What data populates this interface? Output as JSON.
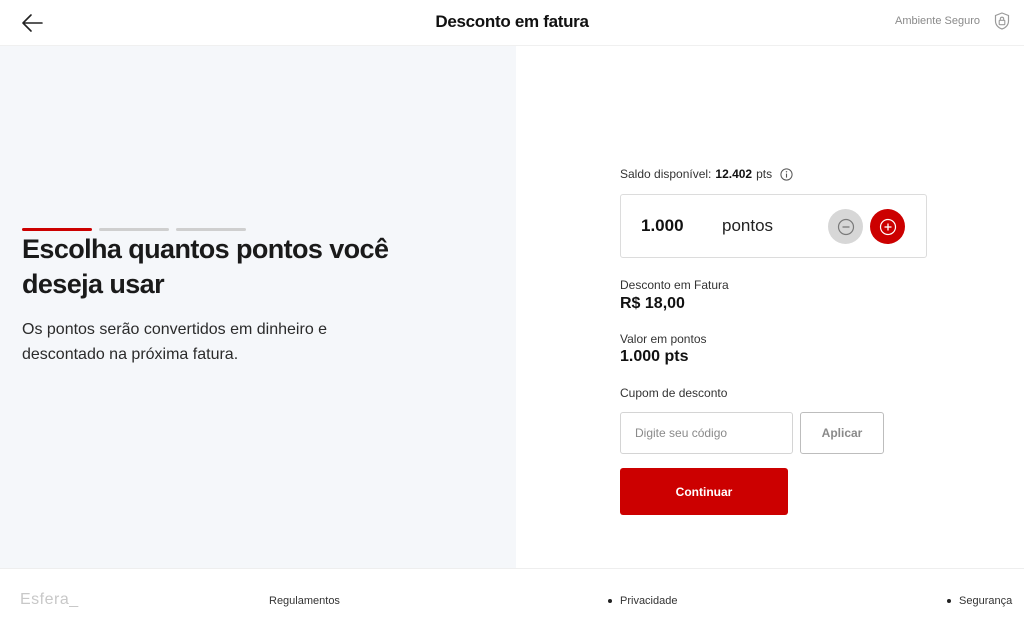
{
  "header": {
    "title": "Desconto em fatura",
    "secure_label": "Ambiente Seguro"
  },
  "hero": {
    "steps_total": 3,
    "current_step": 1,
    "title": "Escolha quantos pontos você deseja usar",
    "description": "Os pontos serão convertidos em dinheiro e descontado na próxima fatura."
  },
  "balance": {
    "label": "Saldo disponível:",
    "value": "12.402",
    "unit": "pts"
  },
  "points": {
    "value": "1.000",
    "unit": "pontos"
  },
  "summary": {
    "discount_label": "Desconto em Fatura",
    "discount_value": "R$ 18,00",
    "points_label": "Valor em pontos",
    "points_value": "1.000 pts"
  },
  "coupon": {
    "label": "Cupom de desconto",
    "placeholder": "Digite seu código",
    "apply_label": "Aplicar"
  },
  "actions": {
    "continue_label": "Continuar"
  },
  "footer": {
    "logo": "Esfera_",
    "links": [
      "Regulamentos",
      "Privacidade",
      "Segurança"
    ]
  },
  "colors": {
    "brand_red": "#cc0000",
    "left_panel_bg": "#f5f7fa"
  },
  "icons": [
    "arrow-left-icon",
    "shield-lock-icon",
    "info-icon",
    "minus-icon",
    "plus-icon"
  ]
}
